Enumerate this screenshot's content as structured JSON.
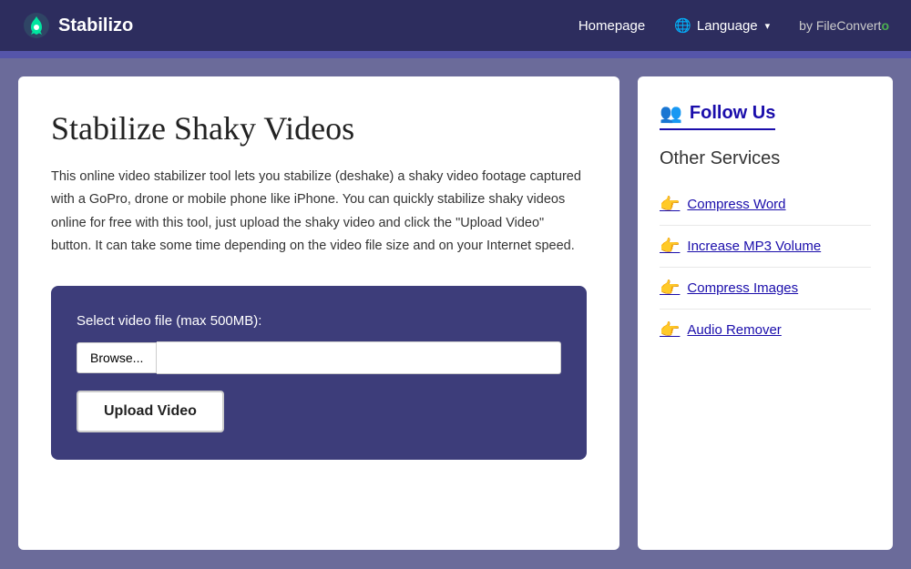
{
  "navbar": {
    "brand": "Stabilizo",
    "logo_emoji": "🚀",
    "nav_links": [
      {
        "label": "Homepage",
        "id": "homepage"
      },
      {
        "label": "Language",
        "id": "language"
      }
    ],
    "language_globe": "🌐",
    "by_text": "by FileConverter",
    "by_highlight": "o"
  },
  "main": {
    "title": "Stabilize Shaky Videos",
    "description": "This online video stabilizer tool lets you stabilize (deshake) a shaky video footage captured with a GoPro, drone or mobile phone like iPhone. You can quickly stabilize shaky videos online for free with this tool, just upload the shaky video and click the \"Upload Video\" button. It can take some time depending on the video file size and on your Internet speed.",
    "upload_box": {
      "label": "Select video file (max 500MB):",
      "browse_btn": "Browse...",
      "file_placeholder": "",
      "upload_btn": "Upload Video"
    }
  },
  "sidebar": {
    "follow_us_emoji": "👥",
    "follow_us_label": "Follow Us",
    "other_services_label": "Other Services",
    "services": [
      {
        "emoji": "👉",
        "label": "Compress Word",
        "id": "compress-word"
      },
      {
        "emoji": "👉",
        "label": "Increase MP3 Volume",
        "id": "increase-mp3"
      },
      {
        "emoji": "👉",
        "label": "Compress Images",
        "id": "compress-images"
      },
      {
        "emoji": "👉",
        "label": "Audio Remover",
        "id": "audio-remover"
      }
    ]
  }
}
